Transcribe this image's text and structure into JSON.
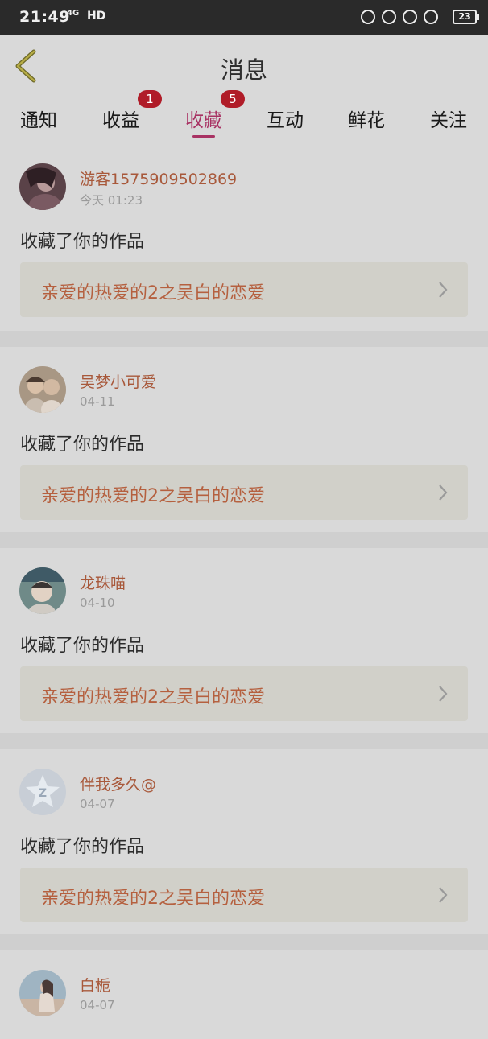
{
  "status": {
    "time": "21:49",
    "network": "4G",
    "hd": "HD",
    "battery": "23"
  },
  "header": {
    "title": "消息"
  },
  "tabs": [
    {
      "label": "通知",
      "badge": ""
    },
    {
      "label": "收益",
      "badge": "1"
    },
    {
      "label": "收藏",
      "badge": "5",
      "active": true
    },
    {
      "label": "互动",
      "badge": ""
    },
    {
      "label": "鲜花",
      "badge": ""
    },
    {
      "label": "关注",
      "badge": ""
    }
  ],
  "messages": [
    {
      "username": "游客1575909502869",
      "time": "今天 01:23",
      "action": "收藏了你的作品",
      "work": "亲爱的热爱的2之吴白的恋爱",
      "avatar": "avatar-dark-portrait"
    },
    {
      "username": "吴梦小可爱",
      "time": "04-11",
      "action": "收藏了你的作品",
      "work": "亲爱的热爱的2之吴白的恋爱",
      "avatar": "avatar-two-people"
    },
    {
      "username": "龙珠喵",
      "time": "04-10",
      "action": "收藏了你的作品",
      "work": "亲爱的热爱的2之吴白的恋爱",
      "avatar": "avatar-child"
    },
    {
      "username": "伴我多久@",
      "time": "04-07",
      "action": "收藏了你的作品",
      "work": "亲爱的热爱的2之吴白的恋爱",
      "avatar": "avatar-qzone-default"
    },
    {
      "username": "白栀",
      "time": "04-07",
      "action": "",
      "work": "",
      "avatar": "avatar-girl-sky"
    }
  ],
  "colors": {
    "accent": "#a83263",
    "badge": "#b01c28",
    "username": "#a8583a",
    "work_title": "#b5603f"
  }
}
